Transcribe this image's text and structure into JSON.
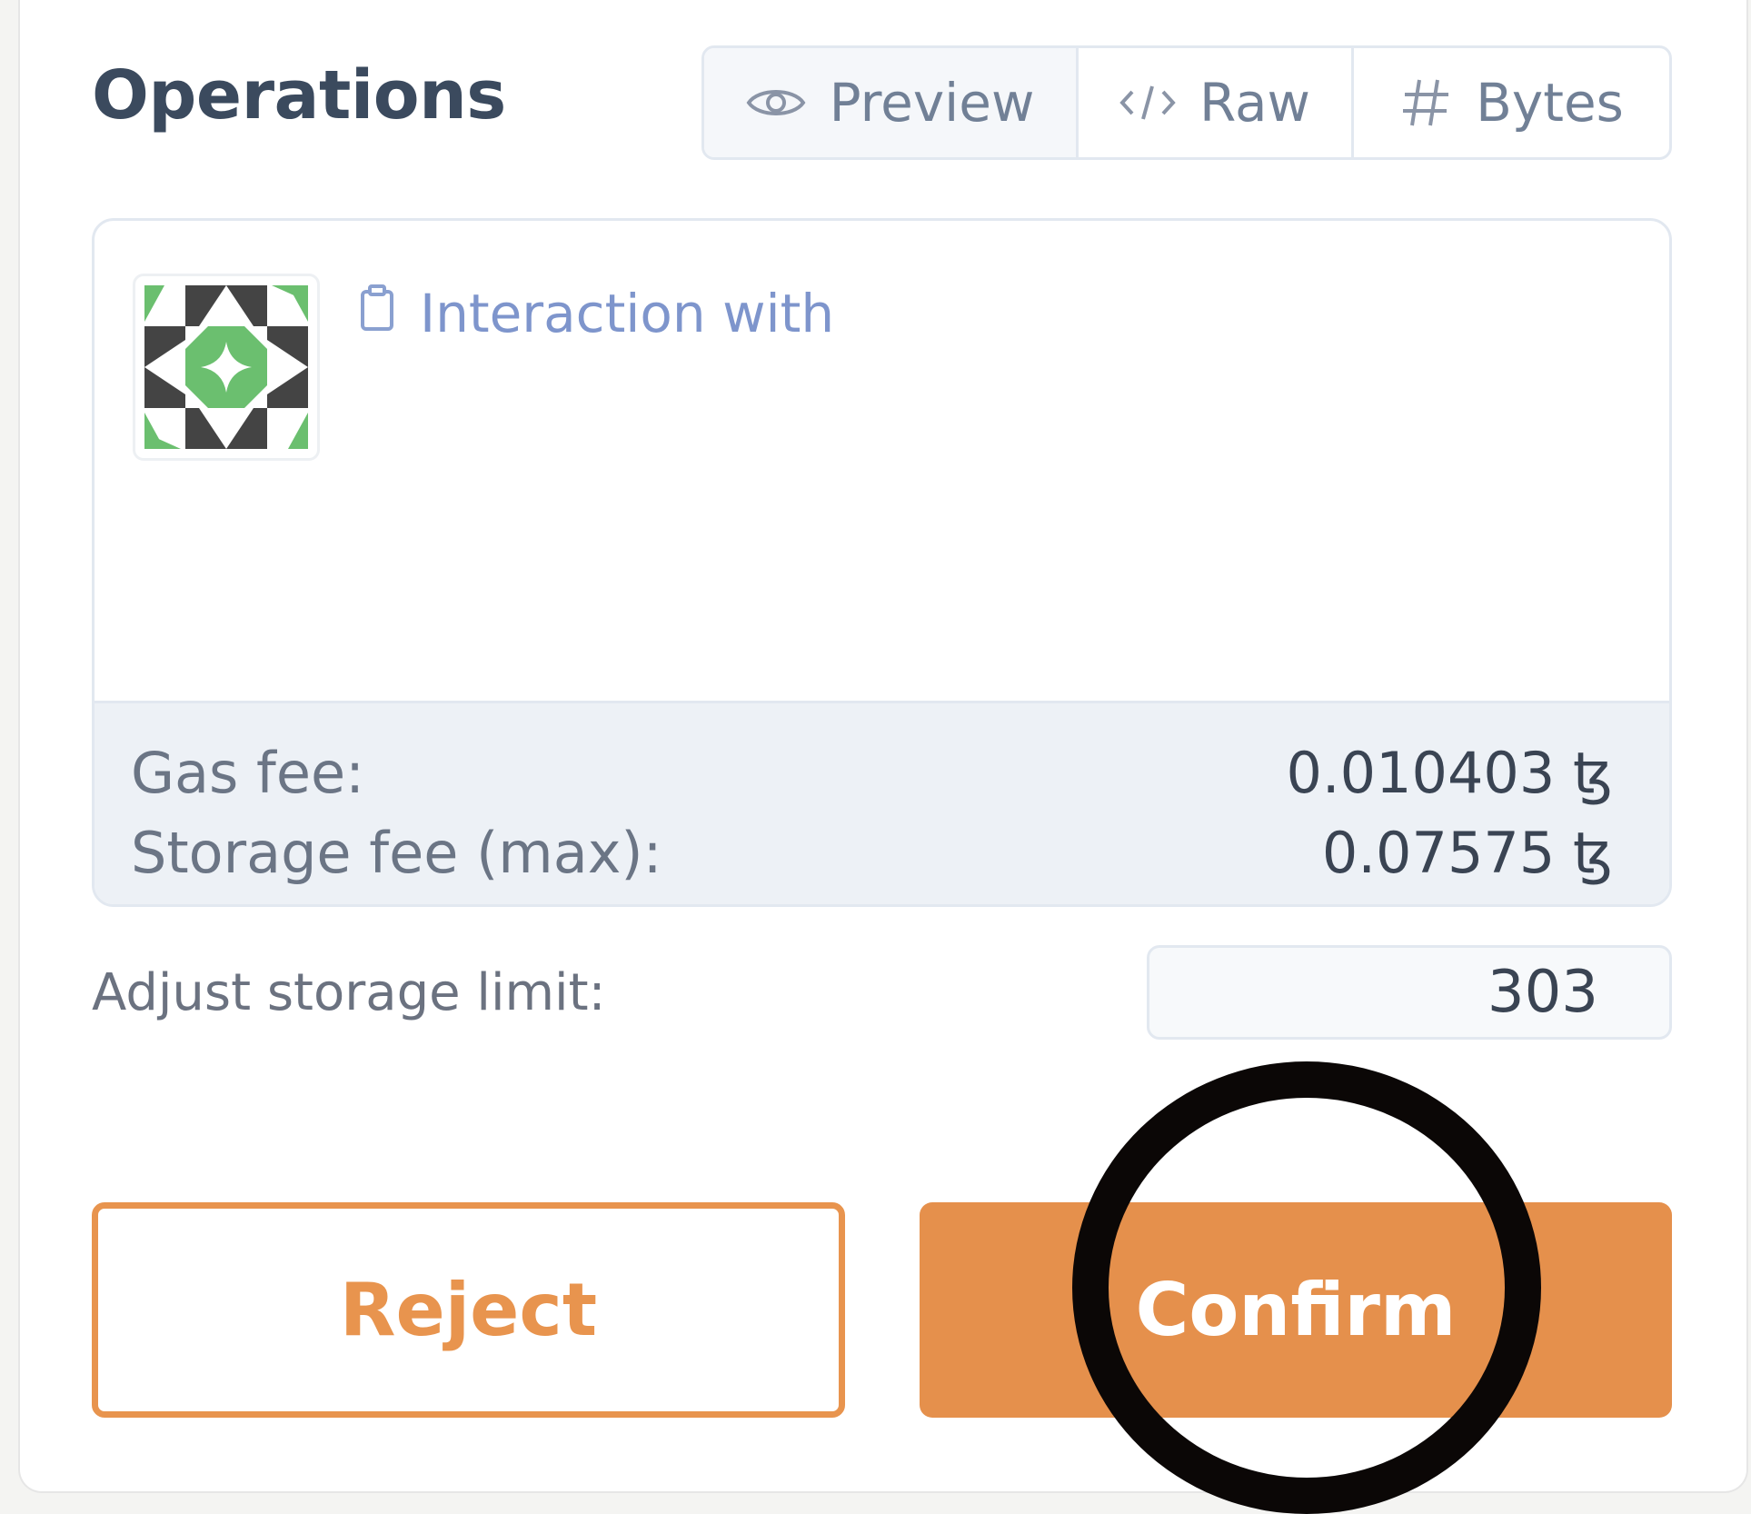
{
  "header": {
    "title": "Operations"
  },
  "view_tabs": [
    {
      "label": "Preview",
      "icon": "eye-icon",
      "active": true
    },
    {
      "label": "Raw",
      "icon": "code-icon",
      "active": false
    },
    {
      "label": "Bytes",
      "icon": "hash-icon",
      "active": false
    }
  ],
  "operation": {
    "avatar_icon": "contract-identicon-icon",
    "interaction_label": "Interaction with"
  },
  "fees": {
    "gas_label": "Gas fee:",
    "gas_value": "0.010403 ꜩ",
    "storage_label": "Storage fee (max):",
    "storage_value": "0.07575 ꜩ"
  },
  "storage_limit": {
    "label": "Adjust storage limit:",
    "value": "303"
  },
  "actions": {
    "reject_label": "Reject",
    "confirm_label": "Confirm"
  },
  "colors": {
    "accent": "#e5904c",
    "title_text": "#3b4a5e",
    "link_blue": "#7e95cc",
    "fee_panel_bg": "#edf1f6",
    "highlight_ring": "#0b0706"
  }
}
